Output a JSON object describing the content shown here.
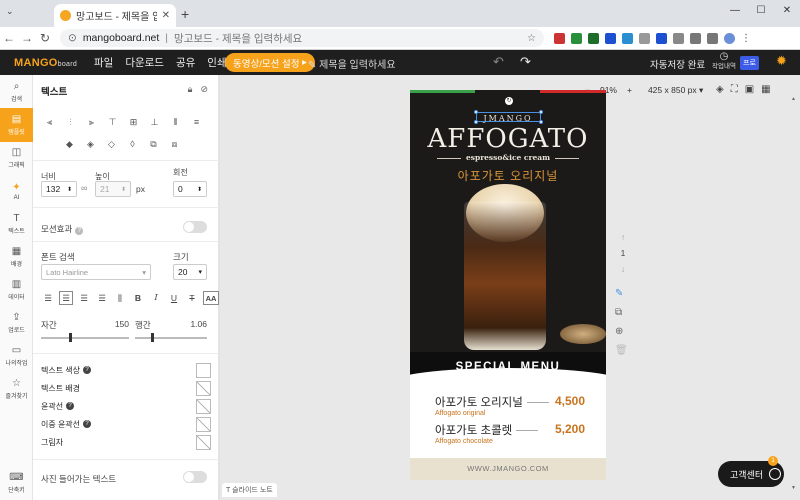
{
  "browser": {
    "tab_title": "망고보드 - 제목을 입력하세요",
    "url": "mangoboard.net",
    "page_title": "망고보드 - 제목을 입력하세요"
  },
  "app": {
    "logo": "MANGO",
    "logo_suffix": "board",
    "menu": [
      "파일",
      "다운로드",
      "공유",
      "인쇄"
    ],
    "animation_button": "동영상/모션 설정",
    "doc_title": "제목을 입력하세요",
    "autosave": "자동저장 완료",
    "history": "작업내역",
    "pro": "프로"
  },
  "sidebar": {
    "items": [
      "검색",
      "템플릿",
      "그래픽",
      "AI",
      "텍스트",
      "배경",
      "데이터",
      "업로드",
      "나의작업",
      "즐겨찾기",
      "단축키"
    ]
  },
  "panel": {
    "title": "텍스트",
    "width_label": "너비",
    "width_value": "132",
    "height_label": "높이",
    "height_value": "21",
    "unit": "px",
    "rotation_label": "회전",
    "rotation_value": "0",
    "motion_label": "모션효과",
    "font_label": "폰트 검색",
    "font_value": "Lato Hairline",
    "size_label": "크기",
    "size_value": "20",
    "spacing_label": "자간",
    "spacing_value": "150",
    "lineheight_label": "행간",
    "lineheight_value": "1.06",
    "text_color": "텍스트 색상",
    "text_bg": "텍스트 배경",
    "outline": "윤곽선",
    "double_outline": "이중 윤곽선",
    "shadow": "그림자",
    "photo_text": "사진 들어가는 텍스트",
    "aa": "AA"
  },
  "canvas": {
    "zoom": "91%",
    "size": "425 x 850 px",
    "page": "1",
    "slide_note": "슬라이드 노트"
  },
  "design": {
    "brand": "JMANGO",
    "title": "AFFOGATO",
    "subtitle": "espresso&ice cream",
    "korean_title": "아포가토 오리지널",
    "special": "SPECIAL MENU",
    "items": [
      {
        "name": "아포가토 오리지널",
        "en": "Affogato original",
        "price": "4,500"
      },
      {
        "name": "아포가토 초콜렛",
        "en": "Affogato chocolate",
        "price": "5,200"
      }
    ],
    "footer": "WWW.JMANGO.COM"
  },
  "help": {
    "label": "고객센터",
    "badge": "1"
  }
}
